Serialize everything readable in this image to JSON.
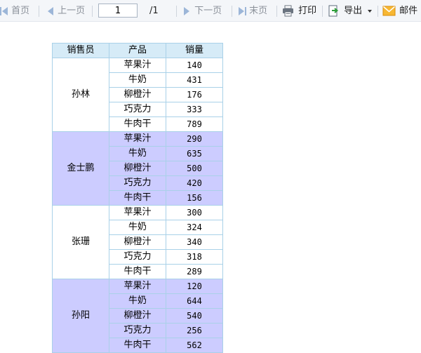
{
  "toolbar": {
    "first_label": "首页",
    "prev_label": "上一页",
    "page_value": "1",
    "page_total": "/1",
    "next_label": "下一页",
    "last_label": "末页",
    "print_label": "打印",
    "export_label": "导出",
    "mail_label": "邮件"
  },
  "table": {
    "headers": [
      "销售员",
      "产品",
      "销量"
    ],
    "groups": [
      {
        "salesperson": "孙林",
        "rows": [
          {
            "product": "苹果汁",
            "qty": "140"
          },
          {
            "product": "牛奶",
            "qty": "431"
          },
          {
            "product": "柳橙汁",
            "qty": "176"
          },
          {
            "product": "巧克力",
            "qty": "333"
          },
          {
            "product": "牛肉干",
            "qty": "789"
          }
        ]
      },
      {
        "salesperson": "金士鹏",
        "rows": [
          {
            "product": "苹果汁",
            "qty": "290"
          },
          {
            "product": "牛奶",
            "qty": "635"
          },
          {
            "product": "柳橙汁",
            "qty": "500"
          },
          {
            "product": "巧克力",
            "qty": "420"
          },
          {
            "product": "牛肉干",
            "qty": "156"
          }
        ]
      },
      {
        "salesperson": "张珊",
        "rows": [
          {
            "product": "苹果汁",
            "qty": "300"
          },
          {
            "product": "牛奶",
            "qty": "324"
          },
          {
            "product": "柳橙汁",
            "qty": "340"
          },
          {
            "product": "巧克力",
            "qty": "318"
          },
          {
            "product": "牛肉干",
            "qty": "289"
          }
        ]
      },
      {
        "salesperson": "孙阳",
        "rows": [
          {
            "product": "苹果汁",
            "qty": "120"
          },
          {
            "product": "牛奶",
            "qty": "644"
          },
          {
            "product": "柳橙汁",
            "qty": "540"
          },
          {
            "product": "巧克力",
            "qty": "256"
          },
          {
            "product": "牛肉干",
            "qty": "562"
          }
        ]
      }
    ]
  },
  "colors": {
    "header_bg": "#d6ebf7",
    "group_highlight": "#ccccff",
    "border": "#a9d1e8",
    "toolbar_bg": "#f4f6f9"
  },
  "icons": [
    "first-page-icon",
    "prev-page-icon",
    "next-page-icon",
    "last-page-icon",
    "printer-icon",
    "export-icon",
    "mail-icon"
  ]
}
